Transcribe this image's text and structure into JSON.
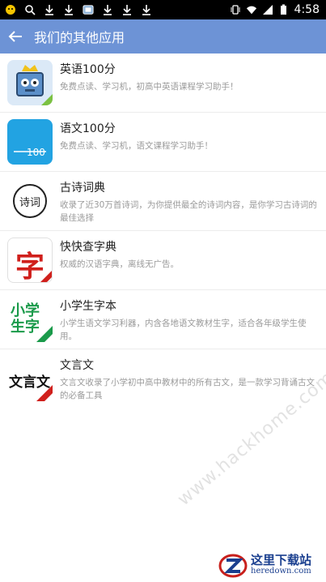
{
  "status_bar": {
    "time": "4:58",
    "icons": [
      "wechat-icon",
      "search-icon",
      "download-icon",
      "download-icon",
      "screenshot-icon",
      "download-icon",
      "download-icon",
      "download-icon",
      "vibrate-icon",
      "wifi-icon",
      "signal-icon",
      "battery-icon"
    ]
  },
  "toolbar": {
    "title": "我们的其他应用",
    "back_icon": "arrow-left-icon",
    "color": "#6d93d6"
  },
  "apps": [
    {
      "name": "英语100分",
      "desc": "免费点读、学习机，初高中英语课程学习助手！",
      "icon": "robot-crown-icon"
    },
    {
      "name": "语文100分",
      "desc": "免费点读、学习机，语文课程学习助手！",
      "icon": "blue-100-icon",
      "icon_text": "100"
    },
    {
      "name": "古诗词典",
      "desc": "收录了近30万首诗词，为你提供最全的诗词内容，是你学习古诗词的最佳选择",
      "icon": "poem-seal-icon",
      "icon_text": "诗词"
    },
    {
      "name": "快快查字典",
      "desc": "权威的汉语字典，离线无广告。",
      "icon": "zi-character-icon",
      "icon_text": "字"
    },
    {
      "name": "小学生字本",
      "desc": "小学生语文学习利器，内含各地语文教材生字，适合各年级学生使用。",
      "icon": "primary-character-icon",
      "icon_text": "小学生字"
    },
    {
      "name": "文言文",
      "desc": "文言文收录了小学初中高中教材中的所有古文，是一款学习背诵古文的必备工具",
      "icon": "classical-chinese-icon",
      "icon_text": "文言文"
    }
  ],
  "watermark": {
    "url": "www.hackhome.com",
    "logo_cn": "这里下载站",
    "logo_en": "heredown.com"
  }
}
